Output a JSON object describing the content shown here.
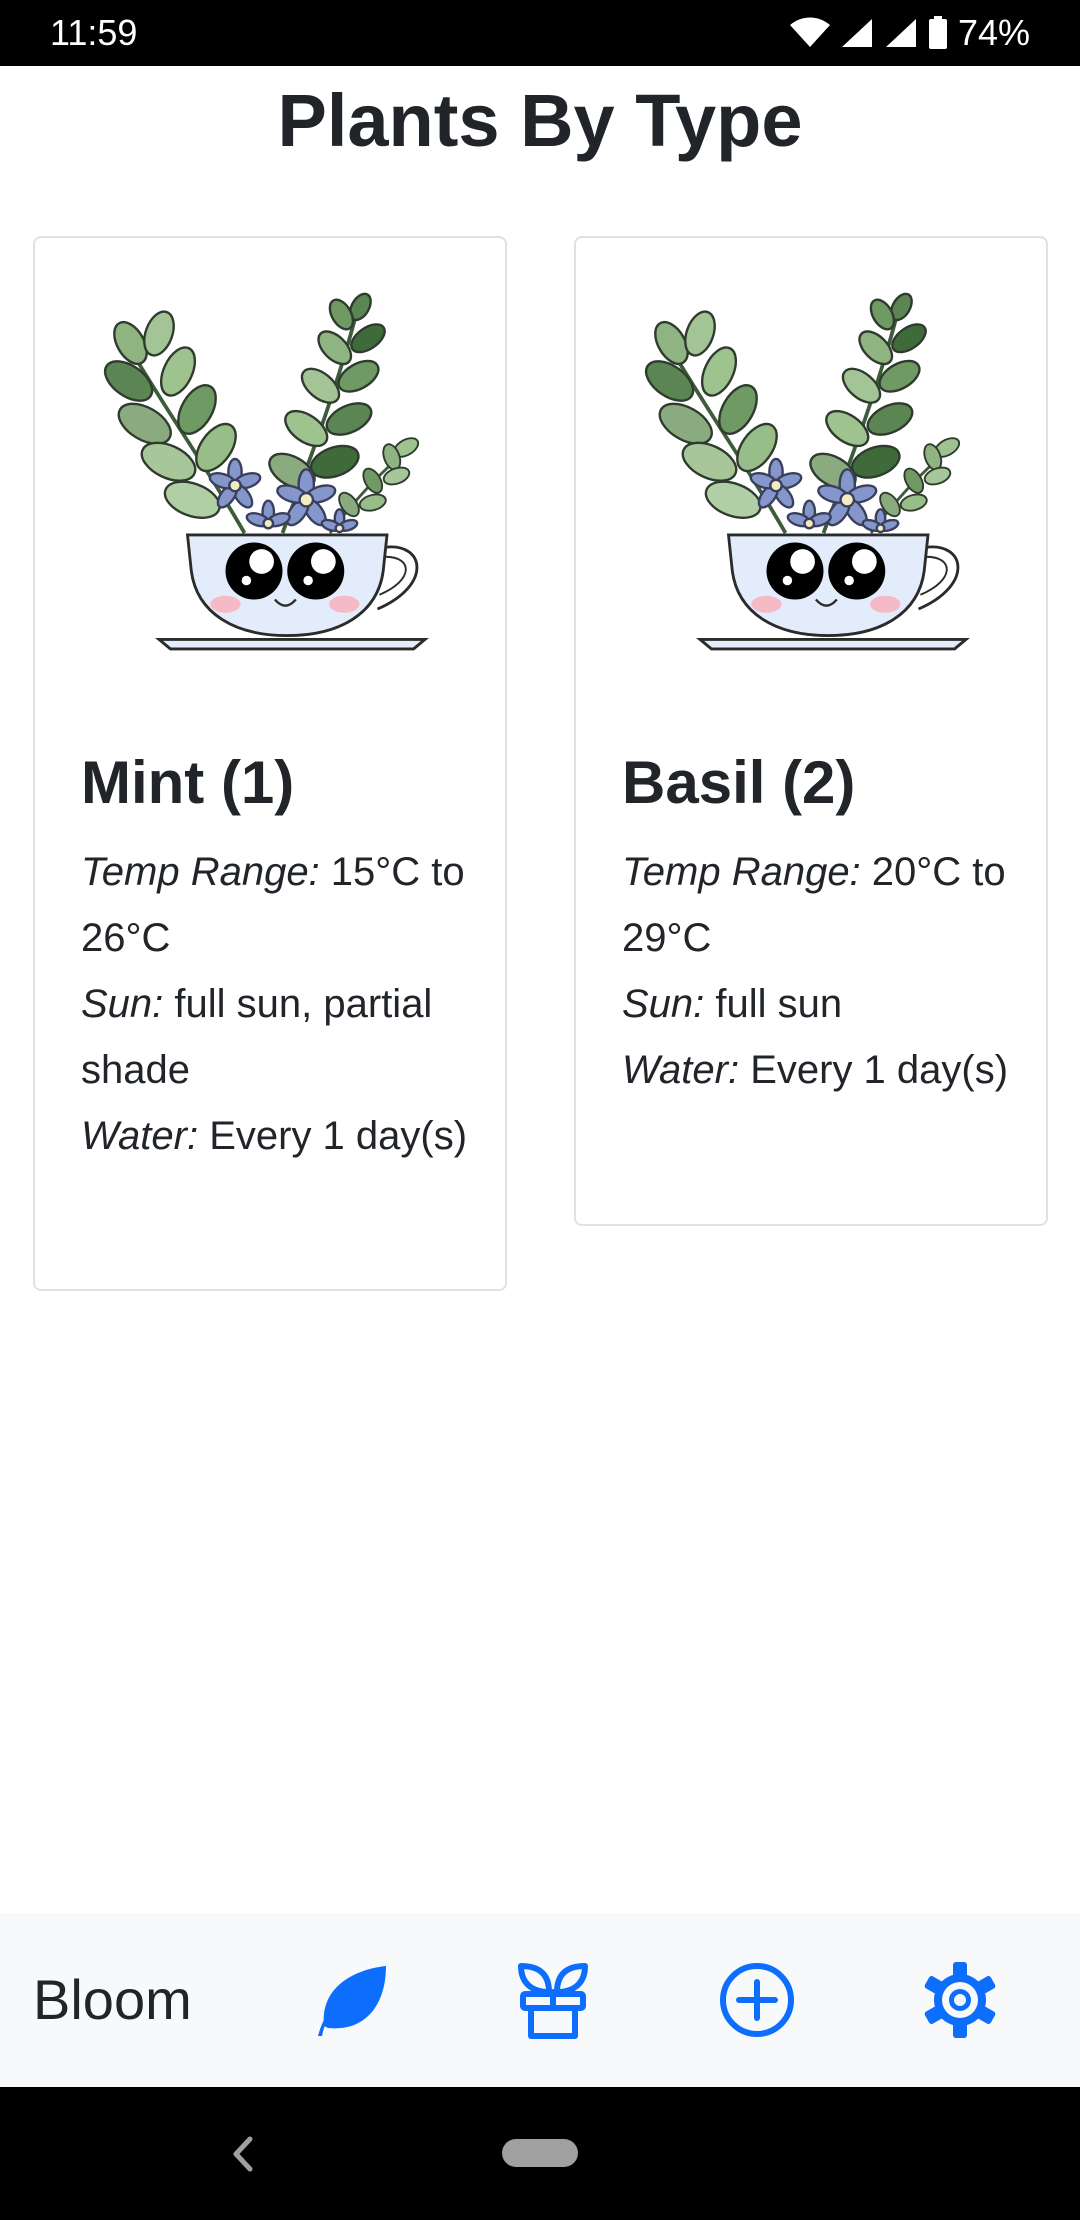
{
  "status_bar": {
    "time": "11:59",
    "battery": "74%"
  },
  "page": {
    "title": "Plants By Type"
  },
  "cards": [
    {
      "title": "Mint (1)",
      "temp_label": "Temp Range:",
      "temp_value": " 15°C to 26°C",
      "sun_label": "Sun:",
      "sun_value": " full sun, partial shade",
      "water_label": "Water:",
      "water_value": " Every 1 day(s)"
    },
    {
      "title": "Basil (2)",
      "temp_label": "Temp Range:",
      "temp_value": " 20°C to 29°C",
      "sun_label": "Sun:",
      "sun_value": " full sun",
      "water_label": "Water:",
      "water_value": " Every 1 day(s)"
    }
  ],
  "bottom_nav": {
    "brand": "Bloom",
    "items": [
      {
        "icon": "leaf-icon"
      },
      {
        "icon": "potted-plant-icon"
      },
      {
        "icon": "plus-circle-icon"
      },
      {
        "icon": "gear-icon"
      }
    ],
    "accent_color": "#0d6efd"
  },
  "system_nav": {
    "back_icon": "back-chevron-icon",
    "home_icon": "home-pill-icon"
  }
}
